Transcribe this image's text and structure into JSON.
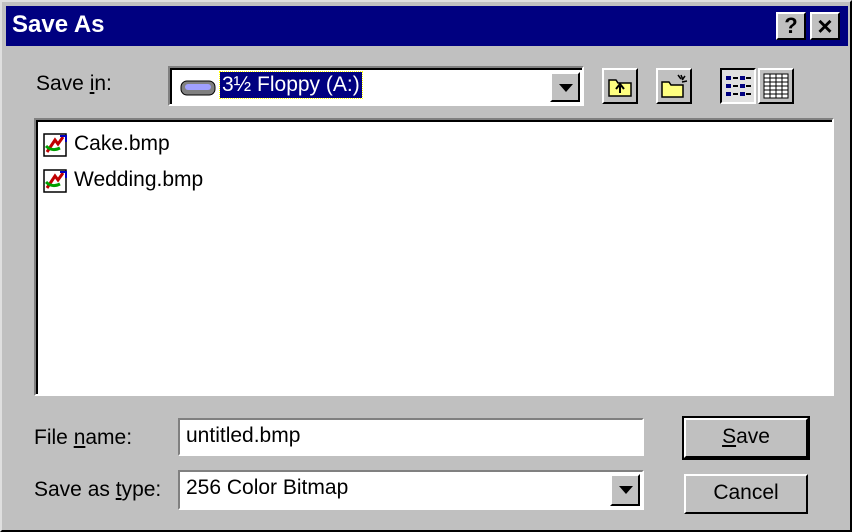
{
  "window": {
    "title": "Save As",
    "help_label": "?",
    "close_label": "×"
  },
  "save_in": {
    "label_pre": "Save ",
    "label_accel": "i",
    "label_post": "n:",
    "value": "3½ Floppy (A:)",
    "icon": "floppy-drive-icon"
  },
  "toolbar": {
    "up_icon": "up-one-level-icon",
    "new_folder_icon": "new-folder-icon",
    "list_icon": "list-view-icon",
    "details_icon": "details-view-icon"
  },
  "files": [
    {
      "name": "Cake.bmp",
      "icon": "bitmap-file-icon"
    },
    {
      "name": "Wedding.bmp",
      "icon": "bitmap-file-icon"
    }
  ],
  "file_name": {
    "label_pre": "File ",
    "label_accel": "n",
    "label_post": "ame:",
    "value": "untitled.bmp"
  },
  "save_as_type": {
    "label_pre": "Save as ",
    "label_accel": "t",
    "label_post": "ype:",
    "value": "256 Color Bitmap"
  },
  "buttons": {
    "save_accel": "S",
    "save_rest": "ave",
    "cancel": "Cancel"
  }
}
